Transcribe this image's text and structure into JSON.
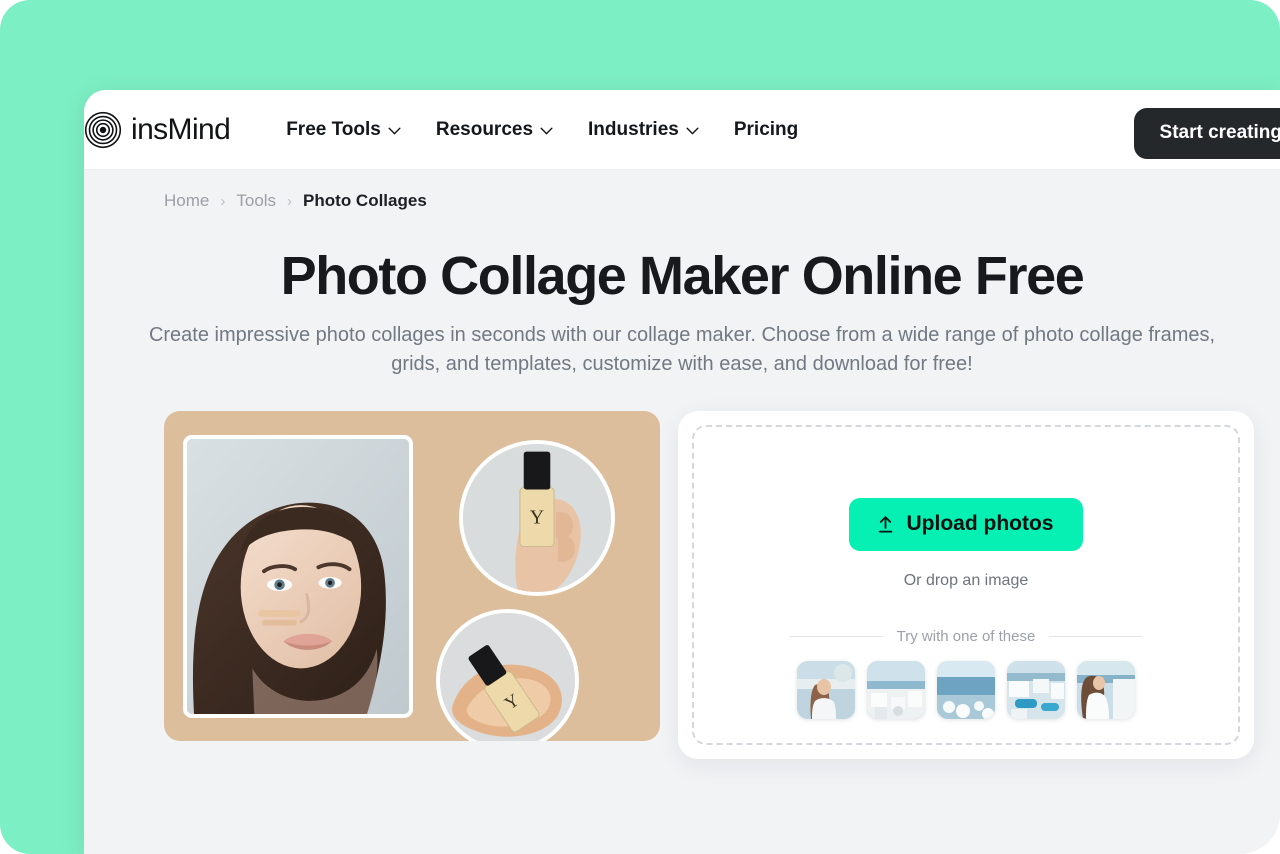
{
  "colors": {
    "mint_backdrop": "#7DEFC4",
    "page_background": "#F2F3F5",
    "accent_green": "#06F0B4",
    "cta_dark": "#25282B",
    "collage_background": "#DDBE9C"
  },
  "header": {
    "brand_name": "insMind",
    "logo_icon": "concentric-rings-logo",
    "nav": [
      {
        "label": "Free Tools",
        "has_dropdown": true,
        "icon": "chevron-down-icon"
      },
      {
        "label": "Resources",
        "has_dropdown": true,
        "icon": "chevron-down-icon"
      },
      {
        "label": "Industries",
        "has_dropdown": true,
        "icon": "chevron-down-icon"
      },
      {
        "label": "Pricing",
        "has_dropdown": false,
        "icon": ""
      }
    ],
    "cta_label": "Start creating"
  },
  "breadcrumb": {
    "items": [
      {
        "label": "Home",
        "current": false
      },
      {
        "label": "Tools",
        "current": false
      },
      {
        "label": "Photo Collages",
        "current": true
      }
    ],
    "separator": "›"
  },
  "hero": {
    "title": "Photo Collage Maker Online Free",
    "subtitle": "Create impressive photo collages in seconds with our collage maker. Choose from a wide range of photo collage frames, grids, and templates, customize with ease, and download for free!"
  },
  "collage_preview": {
    "alt": "beauty product photo collage on tan background",
    "tiles": [
      {
        "name": "portrait-tile",
        "shape": "rounded-rect",
        "description": "close-up portrait of a woman with foundation swatch on cheek"
      },
      {
        "name": "product-hand-tile",
        "shape": "circle",
        "description": "hand holding a foundation bottle with YSL logo"
      },
      {
        "name": "product-swatch-tile",
        "shape": "circle",
        "description": "foundation bottle lying on a beige cream swatch"
      }
    ]
  },
  "uploader": {
    "upload_button_label": "Upload photos",
    "upload_icon": "upload-arrow-icon",
    "drop_hint": "Or drop an image",
    "try_label": "Try with one of these",
    "samples": [
      {
        "name": "sample-1",
        "description": "woman in white dress on Santorini terrace"
      },
      {
        "name": "sample-2",
        "description": "white Santorini village rooftops by the sea"
      },
      {
        "name": "sample-3",
        "description": "blue sea view with white flowers in foreground"
      },
      {
        "name": "sample-4",
        "description": "Santorini white houses with blue pools"
      },
      {
        "name": "sample-5",
        "description": "woman in white dress overlooking the caldera"
      }
    ]
  }
}
